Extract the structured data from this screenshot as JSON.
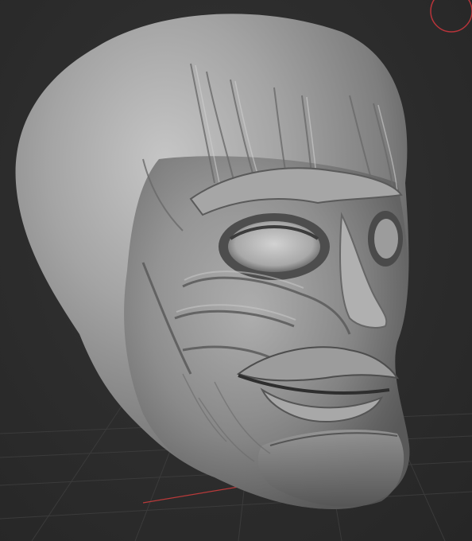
{
  "viewport": {
    "background_color": "#2c2c2c",
    "grid_color": "#3a3a3a",
    "axis_x_color": "#b83a3a",
    "gizmo_color": "#b8343a",
    "model_base_color": "#8e8e8e",
    "model_highlight_color": "#cfcfcf",
    "model_shadow_color": "#3f3f3f"
  },
  "icons": {
    "orientation_gizmo": "orientation-gizmo-icon"
  }
}
